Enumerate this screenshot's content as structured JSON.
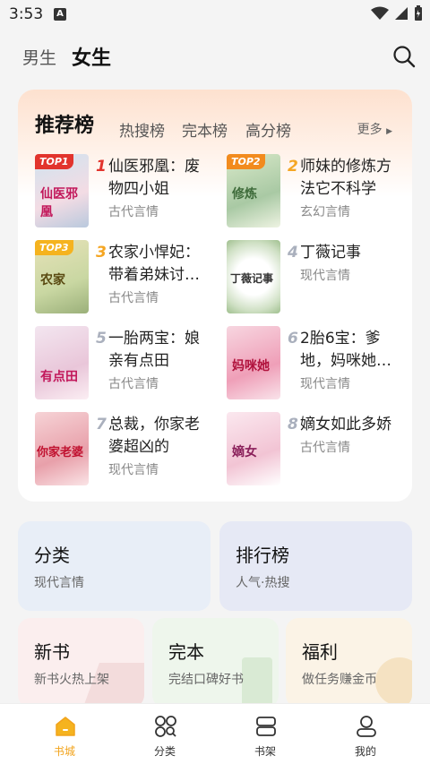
{
  "status_bar": {
    "time": "3:53",
    "notification_badge": "A"
  },
  "top_nav": {
    "tabs": [
      "男生",
      "女生"
    ],
    "active_tab": "女生",
    "search_icon": "search-icon"
  },
  "ranking": {
    "title": "推荐榜",
    "subtabs": [
      "热搜榜",
      "完本榜",
      "高分榜"
    ],
    "more": "更多",
    "books": [
      {
        "rank": "1",
        "badge": "TOP1",
        "name": "仙医邪凰：废物四小姐",
        "genre": "古代言情",
        "cover_text": "仙医邪凰"
      },
      {
        "rank": "2",
        "badge": "TOP2",
        "name": "师妹的修炼方法它不科学",
        "genre": "玄幻言情",
        "cover_text": "修炼"
      },
      {
        "rank": "3",
        "badge": "TOP3",
        "name": "农家小悍妃：带着弟妹讨…",
        "genre": "古代言情",
        "cover_text": "农家"
      },
      {
        "rank": "4",
        "badge": "",
        "name": "丁薇记事",
        "genre": "现代言情",
        "cover_text": "丁薇记事"
      },
      {
        "rank": "5",
        "badge": "",
        "name": "一胎两宝：娘亲有点田",
        "genre": "古代言情",
        "cover_text": "有点田"
      },
      {
        "rank": "6",
        "badge": "",
        "name": "2胎6宝：爹地，妈咪她…",
        "genre": "现代言情",
        "cover_text": "妈咪她"
      },
      {
        "rank": "7",
        "badge": "",
        "name": "总裁，你家老婆超凶的",
        "genre": "现代言情",
        "cover_text": "你家老婆"
      },
      {
        "rank": "8",
        "badge": "",
        "name": "嫡女如此多娇",
        "genre": "古代言情",
        "cover_text": "嫡女"
      }
    ]
  },
  "tiles": [
    {
      "title": "分类",
      "subtitle": "现代言情"
    },
    {
      "title": "排行榜",
      "subtitle": "人气·热搜"
    },
    {
      "title": "新书",
      "subtitle": "新书火热上架"
    },
    {
      "title": "完本",
      "subtitle": "完结口碑好书"
    },
    {
      "title": "福利",
      "subtitle": "做任务赚金币"
    }
  ],
  "bottom_nav": [
    {
      "label": "书城",
      "icon": "home-icon",
      "active": true
    },
    {
      "label": "分类",
      "icon": "category-icon",
      "active": false
    },
    {
      "label": "书架",
      "icon": "bookshelf-icon",
      "active": false
    },
    {
      "label": "我的",
      "icon": "profile-icon",
      "active": false
    }
  ],
  "colors": {
    "accent": "#f2a31b",
    "rank_highlight": "#f5a623",
    "rank_grey": "#aab0bd"
  }
}
